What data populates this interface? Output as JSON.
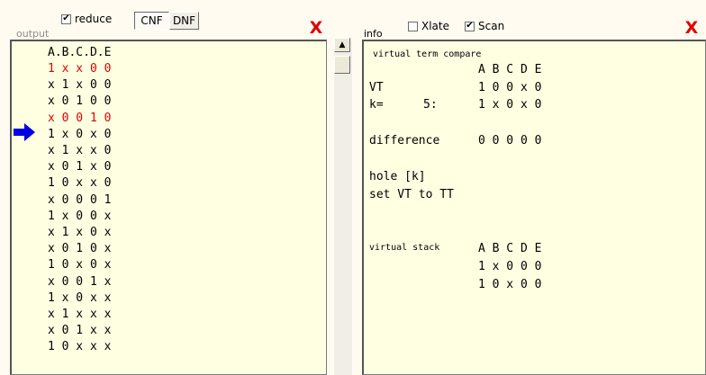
{
  "left_panel": {
    "title": "output",
    "reduce_label": "reduce",
    "reduce_checked": "✔",
    "cnf_label": "CNF",
    "dnf_label": "DNF",
    "close_glyph": "X",
    "header": "A.B.C.D.E",
    "arrow_row": 4,
    "rows": [
      {
        "text": "1 x x 0 0",
        "red": true
      },
      {
        "text": "x 1 x 0 0",
        "red": false
      },
      {
        "text": "x 0 1 0 0",
        "red": false
      },
      {
        "text": "x 0 0 1 0",
        "red": true
      },
      {
        "text": "1 x 0 x 0",
        "red": false
      },
      {
        "text": "x 1 x x 0",
        "red": false
      },
      {
        "text": "x 0 1 x 0",
        "red": false
      },
      {
        "text": "1 0 x x 0",
        "red": false
      },
      {
        "text": "x 0 0 0 1",
        "red": false
      },
      {
        "text": "1 x 0 0 x",
        "red": false
      },
      {
        "text": "x 1 x 0 x",
        "red": false
      },
      {
        "text": "x 0 1 0 x",
        "red": false
      },
      {
        "text": "1 0 x 0 x",
        "red": false
      },
      {
        "text": "x 0 0 1 x",
        "red": false
      },
      {
        "text": "1 x 0 x x",
        "red": false
      },
      {
        "text": "x 1 x x x",
        "red": false
      },
      {
        "text": "x 0 1 x x",
        "red": false
      },
      {
        "text": "1 0 x x x",
        "red": false
      }
    ],
    "arrow_color": "#0000e0"
  },
  "right_panel": {
    "title": "info",
    "xlate_label": "Xlate",
    "xlate_checked": "",
    "scan_label": "Scan",
    "scan_checked": "✔",
    "close_glyph": "X",
    "vt_compare_title": "virtual term compare",
    "vt_header": "A B C D E",
    "vt_label": "VT",
    "vt_value": "1 0 0 x 0",
    "k_label": "k=",
    "k_value": "5:",
    "k_term": "1 x 0 x 0",
    "difference_label": "difference",
    "difference_value": "0 0 0 0 0",
    "hole_line": "hole [k]",
    "set_line": "set VT to TT",
    "stack_title": "virtual stack",
    "stack_header": "A B C D E",
    "stack_rows": [
      "1 x 0 0 0",
      "1 0 x 0 0"
    ]
  },
  "scrollbar": {
    "up_glyph": "▲"
  }
}
